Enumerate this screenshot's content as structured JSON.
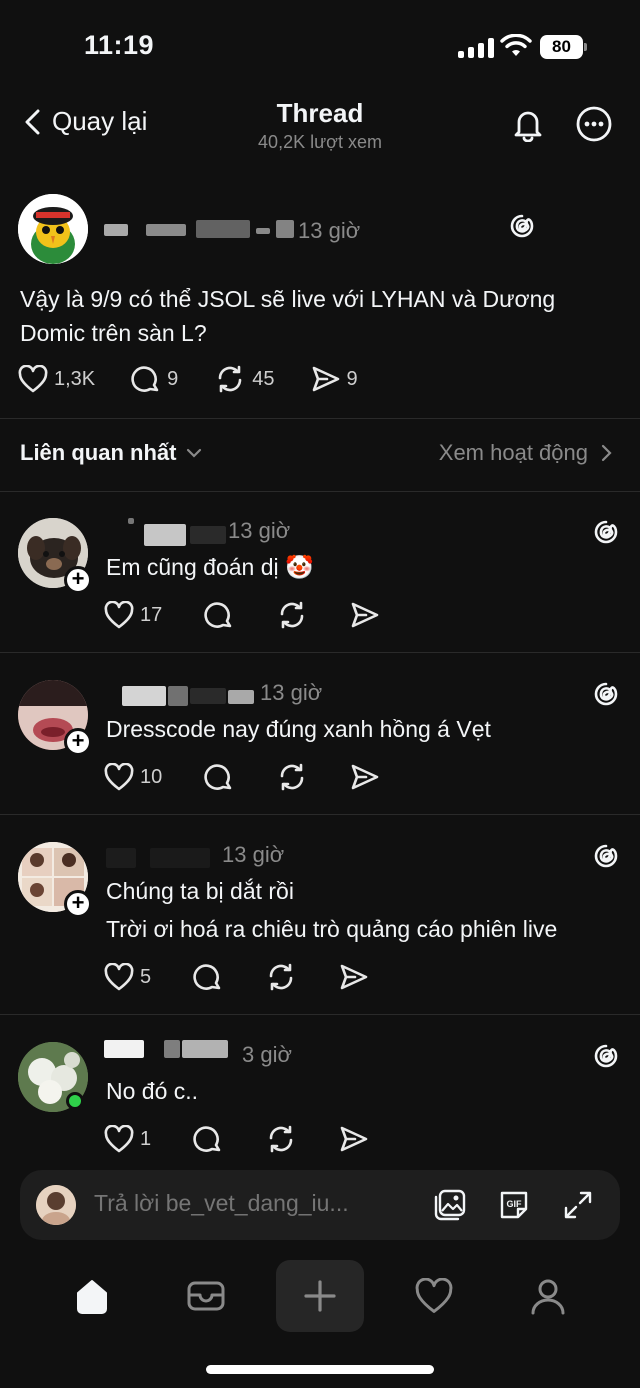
{
  "status": {
    "time": "11:19",
    "battery": "80"
  },
  "nav": {
    "back_label": "Quay lại",
    "title": "Thread",
    "subtitle": "40,2K lượt xem"
  },
  "post": {
    "time": "13 giờ",
    "text": "Vậy là 9/9 có thể JSOL sẽ live với LYHAN và Dương Domic trên sàn L?",
    "likes": "1,3K",
    "replies": "9",
    "reposts": "45",
    "shares": "9"
  },
  "sort": {
    "label": "Liên quan nhất",
    "activity": "Xem hoạt động"
  },
  "replies": [
    {
      "time": "13 giờ",
      "text": "Em cũng đoán dị 🤡",
      "likes": "17"
    },
    {
      "time": "13 giờ",
      "text": "Dresscode nay đúng xanh hồng á Vẹt",
      "likes": "10"
    },
    {
      "time": "13 giờ",
      "text": "Chúng ta bị dắt rồi",
      "text2": "Trời ơi hoá ra chiêu trò quảng cáo phiên live",
      "likes": "5"
    },
    {
      "time": "3 giờ",
      "text": "No đó c..",
      "likes": "1"
    }
  ],
  "composer": {
    "placeholder": "Trả lời be_vet_dang_iu..."
  },
  "colors": {
    "background": "#101010",
    "text": "#f3f5f7",
    "muted": "#8a8a8a",
    "online": "#2fd14a"
  }
}
